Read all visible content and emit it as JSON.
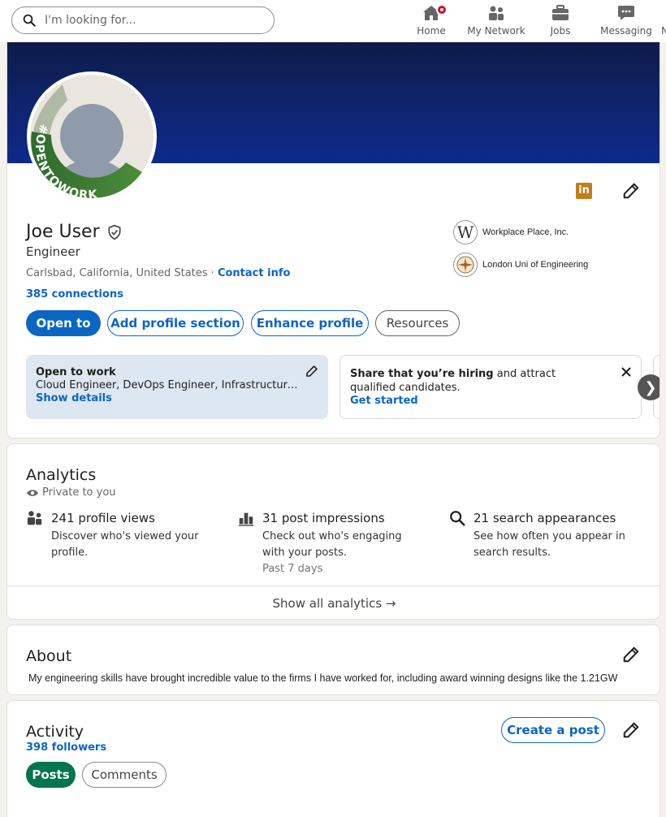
{
  "nav": {
    "search_placeholder": "I'm looking for...",
    "items": [
      {
        "label": "Home",
        "icon": "home-icon"
      },
      {
        "label": "My Network",
        "icon": "network-icon"
      },
      {
        "label": "Jobs",
        "icon": "briefcase-icon"
      },
      {
        "label": "Messaging",
        "icon": "messaging-icon"
      }
    ],
    "overflow_glyph": "N"
  },
  "profile": {
    "frame_text": "#OPENTOWORK",
    "logo_text": "in",
    "name": "Joe User",
    "headline": "Engineer",
    "location": "Carlsbad, California, United States",
    "separator": " · ",
    "contact_label": "Contact info",
    "connections": "385 connections",
    "organizations": [
      {
        "name": "Workplace Place, Inc.",
        "logo_text": "W"
      },
      {
        "name": "London Uni of Engineering"
      }
    ],
    "buttons": {
      "open_to": "Open to",
      "add_section": "Add profile section",
      "enhance": "Enhance profile",
      "resources": "Resources"
    },
    "open_to_work": {
      "title": "Open to work",
      "roles": "Cloud Engineer, DevOps Engineer, Infrastructure Engineer",
      "link": "Show details"
    },
    "hiring": {
      "bold": "Share that you’re hiring",
      "rest": " and attract qualified candidates.",
      "link": "Get started"
    },
    "next_glyph": "❯"
  },
  "analytics": {
    "title": "Analytics",
    "visibility": "Private to you",
    "metrics": [
      {
        "title": "241 profile views",
        "desc": "Discover who's viewed your profile.",
        "icon": "people-icon"
      },
      {
        "title": "31 post impressions",
        "desc": "Check out who's engaging with your posts.",
        "period": "Past 7 days",
        "icon": "bar-chart-icon"
      },
      {
        "title": "21 search appearances",
        "desc": "See how often you appear in search results.",
        "icon": "search-icon"
      }
    ],
    "show_all": "Show all analytics →"
  },
  "about": {
    "title": "About",
    "text": "My engineering skills have brought incredible value to the firms I have worked for, including award winning designs like the 1.21GW"
  },
  "activity": {
    "title": "Activity",
    "followers": "398 followers",
    "create_post": "Create a post",
    "tabs": [
      "Posts",
      "Comments"
    ]
  },
  "colors": {
    "accent": "#0a66c2",
    "open_to_work_green": "#01754f",
    "banner": "#0f2470",
    "notification": "#cb112d"
  }
}
